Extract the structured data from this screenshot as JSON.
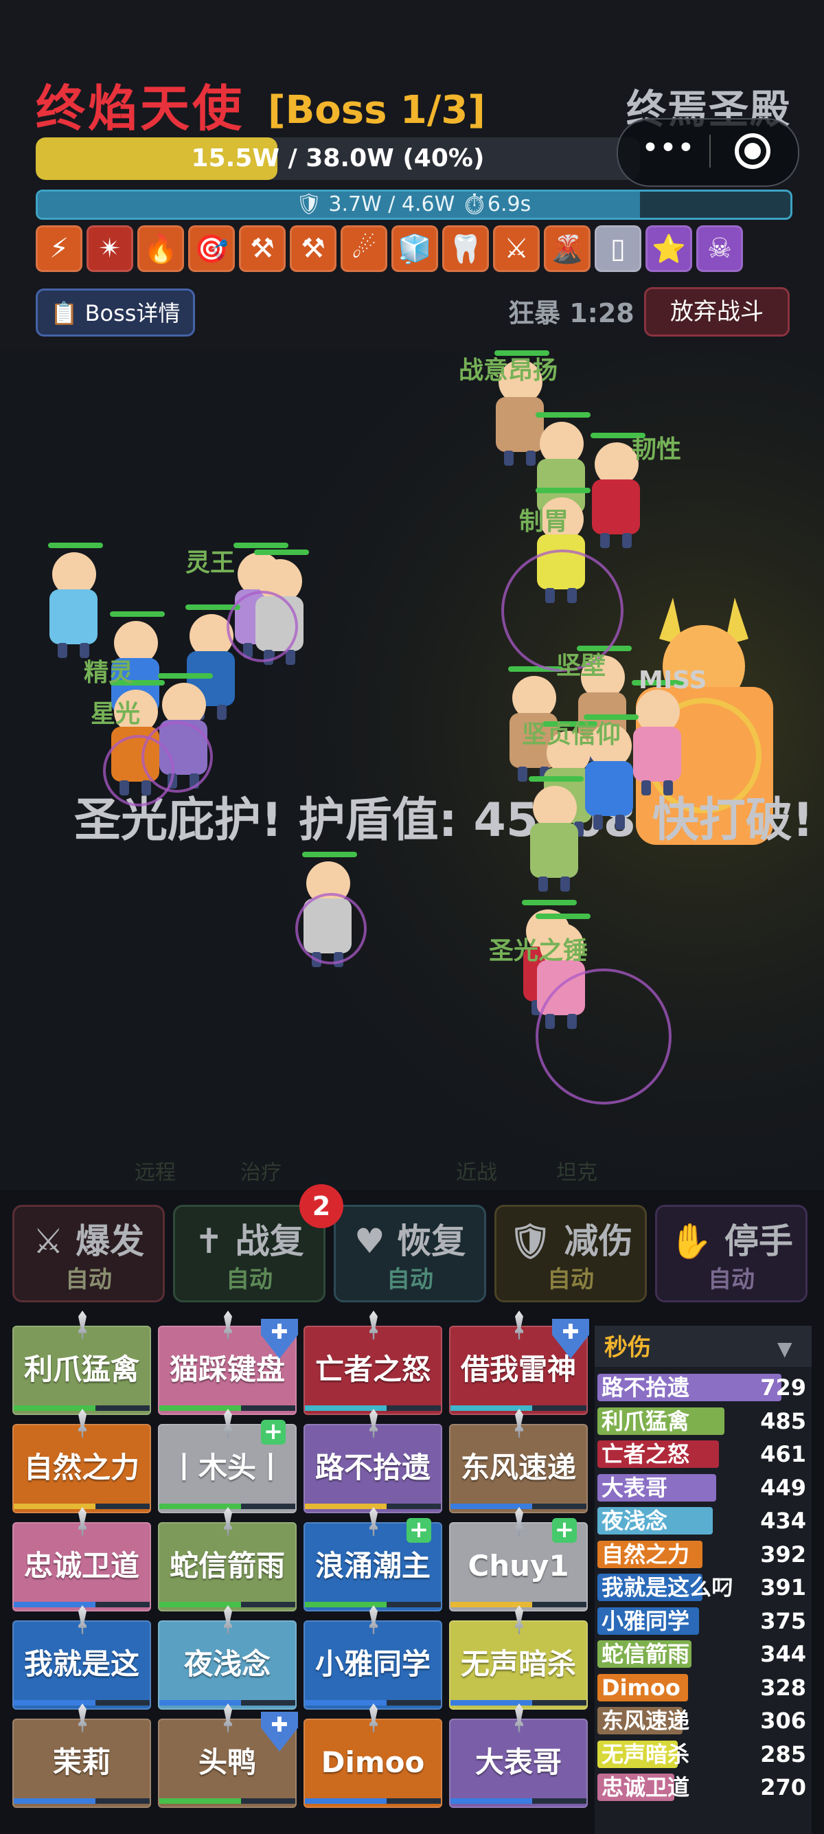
{
  "boss": {
    "name": "终焰天使",
    "count": "[Boss 1/3]",
    "location": "终焉圣殿",
    "hp_text": "15.5W / 38.0W (40%)",
    "hp_fraction": 0.4,
    "shield_text": "🛡 3.7W / 4.6W  ⏱6.9s",
    "shield_fraction": 0.8
  },
  "mini_program": {
    "more_icon": "more-dots-icon",
    "close_icon": "close-target-icon"
  },
  "buff_icons": [
    {
      "icon": "⚡",
      "color": "#d45a22"
    },
    {
      "icon": "✴",
      "color": "#b83226"
    },
    {
      "icon": "🔥",
      "color": "#d45a22"
    },
    {
      "icon": "🎯",
      "color": "#d45a22"
    },
    {
      "icon": "⚒",
      "color": "#d45a22"
    },
    {
      "icon": "⚒",
      "color": "#d45a22"
    },
    {
      "icon": "☄",
      "color": "#d45a22"
    },
    {
      "icon": "🧊",
      "color": "#d45a22"
    },
    {
      "icon": "🦷",
      "color": "#d45a22"
    },
    {
      "icon": "⚔",
      "color": "#d45a22"
    },
    {
      "icon": "🌋",
      "color": "#d45a22"
    },
    {
      "icon": "▯",
      "color": "#a0a4b8"
    },
    {
      "icon": "⭐",
      "color": "#8a4fc0"
    },
    {
      "icon": "☠",
      "color": "#8a4fc0"
    }
  ],
  "controls": {
    "boss_detail": "📋 Boss详情",
    "rage_timer": "狂暴 1:28",
    "give_up": "放弃战斗"
  },
  "battle": {
    "banner": "圣光庇护! 护盾值: 45608 快打破!",
    "floating_texts": [
      {
        "text": "战意昂扬",
        "color": "#76b257"
      },
      {
        "text": "韧性",
        "color": "#76b257"
      },
      {
        "text": "制胃",
        "color": "#76b257"
      },
      {
        "text": "灵王",
        "color": "#76b257"
      },
      {
        "text": "精灵",
        "color": "#76b257"
      },
      {
        "text": "星光",
        "color": "#76b257"
      },
      {
        "text": "MISS",
        "color": "#cfcfcf"
      },
      {
        "text": "坚壁",
        "color": "#76b257"
      },
      {
        "text": "坚贞信仰",
        "color": "#76b257"
      },
      {
        "text": "圣光之锤",
        "color": "#76b257"
      }
    ],
    "zones": [
      "远程",
      "治疗",
      "近战",
      "坦克"
    ]
  },
  "skills": [
    {
      "icon": "⚔",
      "title": "爆发",
      "mode": "自动",
      "bg": "#2a1c20",
      "border": "#5a2e34",
      "mode_color": "#8a8e70"
    },
    {
      "icon": "✝",
      "title": "战复",
      "mode": "自动",
      "bg": "#1c2a22",
      "border": "#2f4a38",
      "mode_color": "#5e8a56"
    },
    {
      "icon": "♥",
      "title": "恢复",
      "mode": "自动",
      "bg": "#1a2a30",
      "border": "#2e4a56",
      "mode_color": "#4e8a78"
    },
    {
      "icon": "🛡",
      "title": "减伤",
      "mode": "自动",
      "bg": "#2a2618",
      "border": "#4a4226",
      "mode_color": "#8a8040"
    },
    {
      "icon": "✋",
      "title": "停手",
      "mode": "自动",
      "bg": "#231c2e",
      "border": "#3e2f52",
      "mode_color": "#7a6a90"
    }
  ],
  "badge_count": "2",
  "team_cards": [
    {
      "label": "利爪猛禽",
      "color": "#7d9a5a",
      "bar": "#46c04a"
    },
    {
      "label": "猫踩键盘",
      "color": "#c26d94",
      "bar": "#46c04a"
    },
    {
      "label": "亡者之怒",
      "color": "#a22c3a",
      "bar": "#3fb6c9"
    },
    {
      "label": "借我雷神",
      "color": "#a22c3a",
      "bar": "#3fb6c9"
    },
    {
      "label": "自然之力",
      "color": "#cc6a1e",
      "bar": "#e6b834"
    },
    {
      "label": "丨木头丨",
      "color": "#a2a4aa",
      "bar": "#46c04a"
    },
    {
      "label": "路不拾遗",
      "color": "#7a5fa8",
      "bar": "#e6b834"
    },
    {
      "label": "东风速递",
      "color": "#8a6a4c",
      "bar": "#3a7de0"
    },
    {
      "label": "忠诚卫道",
      "color": "#c26d94",
      "bar": "#3a7de0"
    },
    {
      "label": "蛇信箭雨",
      "color": "#7d9a5a",
      "bar": "#46c04a"
    },
    {
      "label": "浪涌潮主",
      "color": "#2a6ab8",
      "bar": "#46c04a"
    },
    {
      "label": "Chuy1",
      "color": "#a2a4aa",
      "bar": "#e6b834"
    },
    {
      "label": "我就是这",
      "color": "#2a6ab8",
      "bar": "#3a7de0"
    },
    {
      "label": "夜浅念",
      "color": "#5aa0c2",
      "bar": "#3a7de0"
    },
    {
      "label": "小雅同学",
      "color": "#2a6ab8",
      "bar": "#3a7de0"
    },
    {
      "label": "无声暗杀",
      "color": "#c4c44c",
      "bar": "#3a7de0"
    },
    {
      "label": "茉莉",
      "color": "#8a6a4c",
      "bar": "#3a7de0"
    },
    {
      "label": "头鸭",
      "color": "#8a6a4c",
      "bar": "#46c04a"
    },
    {
      "label": "Dimoo",
      "color": "#cc6a1e",
      "bar": "#3a7de0"
    },
    {
      "label": "大表哥",
      "color": "#7a5fa8",
      "bar": "#3a7de0"
    }
  ],
  "dps": {
    "title": "秒伤",
    "caret": "▼",
    "rows": [
      {
        "name": "路不拾遗",
        "value": "729",
        "color": "#8a6fc4"
      },
      {
        "name": "利爪猛禽",
        "value": "485",
        "color": "#7fb04e"
      },
      {
        "name": "亡者之怒",
        "value": "461",
        "color": "#b02a3c"
      },
      {
        "name": "大表哥",
        "value": "449",
        "color": "#8a6fc4"
      },
      {
        "name": "夜浅念",
        "value": "434",
        "color": "#5aaed0"
      },
      {
        "name": "自然之力",
        "value": "392",
        "color": "#e07a22"
      },
      {
        "name": "我就是这么叼",
        "value": "391",
        "color": "#2a6ab8"
      },
      {
        "name": "小雅同学",
        "value": "375",
        "color": "#2a6ab8"
      },
      {
        "name": "蛇信箭雨",
        "value": "344",
        "color": "#7fb04e"
      },
      {
        "name": "Dimoo",
        "value": "328",
        "color": "#e07a22"
      },
      {
        "name": "东风速递",
        "value": "306",
        "color": "#8a6a4c"
      },
      {
        "name": "无声暗杀",
        "value": "285",
        "color": "#d8d83a"
      },
      {
        "name": "忠诚卫道",
        "value": "270",
        "color": "#c26d94"
      }
    ]
  }
}
